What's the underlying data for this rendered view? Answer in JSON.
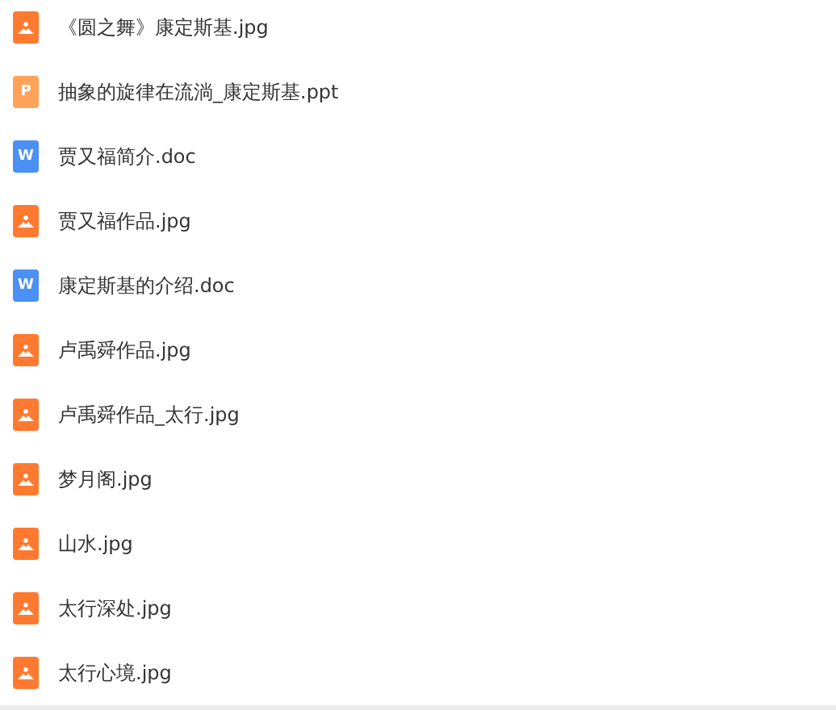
{
  "files": [
    {
      "name": "《圆之舞》康定斯基.jpg",
      "kind": "image"
    },
    {
      "name": "抽象的旋律在流淌_康定斯基.ppt",
      "kind": "slides",
      "icon_letter": "P"
    },
    {
      "name": "贾又福简介.doc",
      "kind": "document",
      "icon_letter": "W"
    },
    {
      "name": "贾又福作品.jpg",
      "kind": "image"
    },
    {
      "name": "康定斯基的介绍.doc",
      "kind": "document",
      "icon_letter": "W"
    },
    {
      "name": "卢禹舜作品.jpg",
      "kind": "image"
    },
    {
      "name": "卢禹舜作品_太行.jpg",
      "kind": "image"
    },
    {
      "name": "梦月阁.jpg",
      "kind": "image"
    },
    {
      "name": "山水.jpg",
      "kind": "image"
    },
    {
      "name": "太行深处.jpg",
      "kind": "image"
    },
    {
      "name": "太行心境.jpg",
      "kind": "image"
    }
  ]
}
